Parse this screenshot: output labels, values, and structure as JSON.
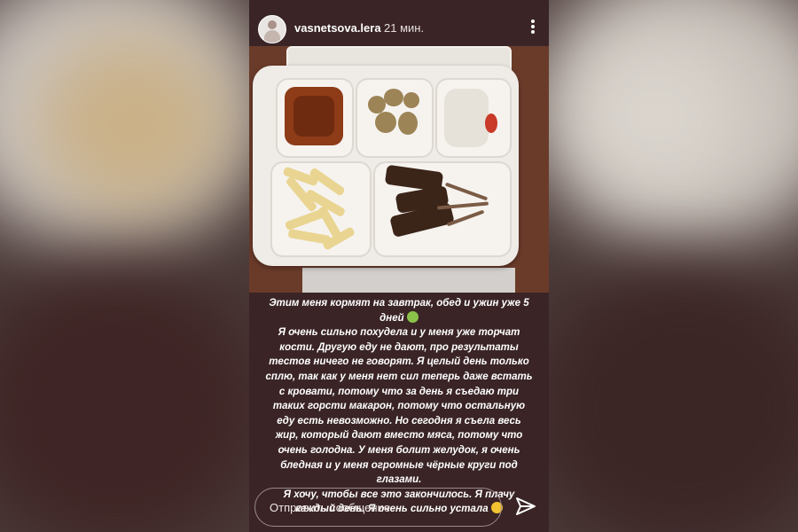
{
  "story": {
    "username": "vasnetsova.lera",
    "time": "21 мин.",
    "caption": [
      "Этим меня кормят на завтрак, обед и ужин уже 5 дней",
      "Я очень сильно похудела и у меня уже торчат кости. Другую еду не дают, про результаты тестов ничего не говорят. Я целый день только сплю, так как у меня нет сил теперь даже встать с кровати, потому что за день я съедаю три таких горсти макарон, потому что остальную еду есть невозможно. Но сегодня я съела весь жир, который дают вместо мяса, потому что очень голодна. У меня болит желудок, я очень бледная и у меня огромные чёрные круги под глазами.",
      "Я хочу, чтобы все это закончилось. Я плачу каждый день. Я очень сильно устала"
    ],
    "emoji": [
      "nauseated-face-emoji",
      "weary-face-emoji"
    ]
  },
  "reply": {
    "placeholder": "Отправить сообщение"
  },
  "icons": {
    "menu": "more-vertical-icon",
    "send": "paper-plane-icon"
  }
}
